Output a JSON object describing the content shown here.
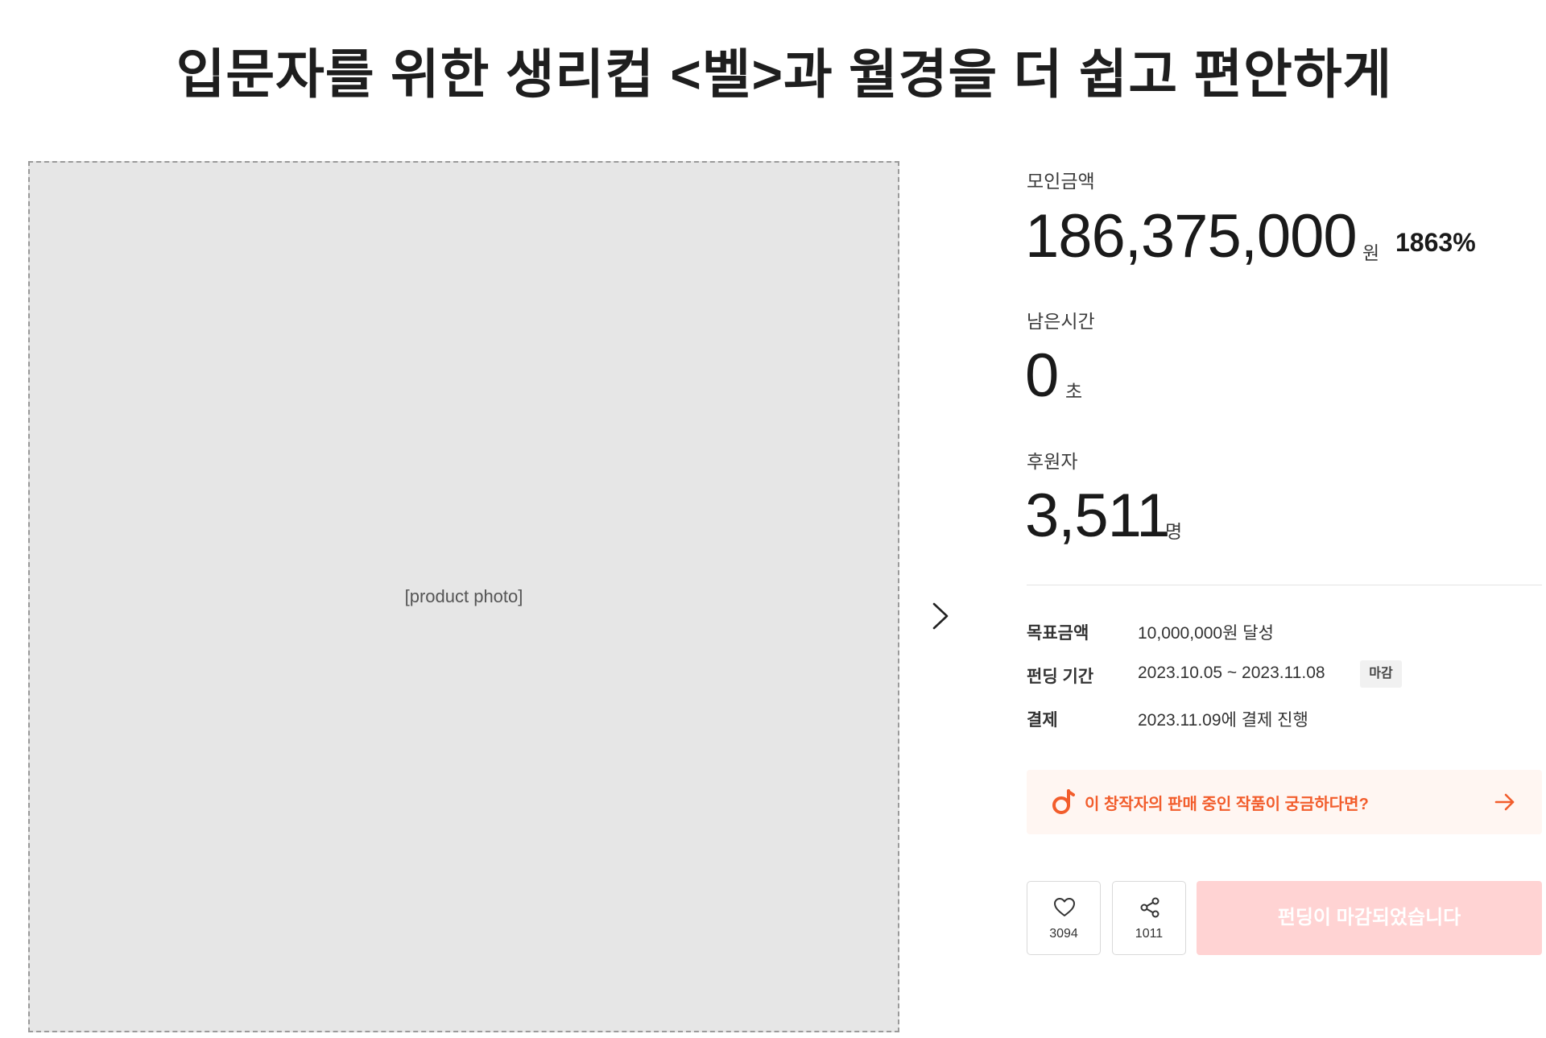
{
  "project": {
    "title": "입문자를 위한 생리컵 <벨>과 월경을 더 쉽고 편안하게"
  },
  "stats": {
    "amount_label": "모인금액",
    "amount_value": "186,375,000",
    "amount_unit": "원",
    "amount_percent": "1863%",
    "time_label": "남은시간",
    "time_value": "0",
    "time_unit": "초",
    "backers_label": "후원자",
    "backers_value": "3,511",
    "backers_unit": "명"
  },
  "info": {
    "goal_label": "목표금액",
    "goal_value": "10,000,000원 달성",
    "period_label": "펀딩 기간",
    "period_value": "2023.10.05 ~ 2023.11.08",
    "period_badge": "마감",
    "payment_label": "결제",
    "payment_value": "2023.11.09에 결제 진행"
  },
  "store_banner": {
    "text": "이 창작자의 판매 중인 작품이 궁금하다면?",
    "icon": "creator-store-icon",
    "accent_color": "#f25d2c"
  },
  "actions": {
    "like_count": "3094",
    "share_count": "1011",
    "closed_label": "펀딩이 마감되었습니다",
    "closed_color": "#ffd3d3"
  },
  "media": {
    "image_caption": "[product photo]"
  }
}
